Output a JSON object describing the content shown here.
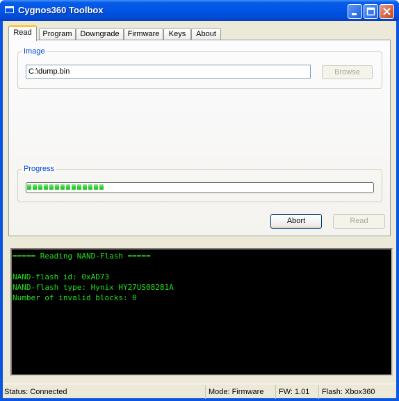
{
  "window": {
    "title": "Cygnos360 Toolbox"
  },
  "tabs": [
    {
      "label": "Read",
      "active": true
    },
    {
      "label": "Program",
      "active": false
    },
    {
      "label": "Downgrade",
      "active": false
    },
    {
      "label": "Firmware",
      "active": false
    },
    {
      "label": "Keys",
      "active": false
    },
    {
      "label": "About",
      "active": false
    }
  ],
  "image_group": {
    "label": "Image",
    "path_value": "C:\\dump.bin",
    "browse_label": "Browse"
  },
  "progress_group": {
    "label": "Progress",
    "progress_fraction": 0.23
  },
  "buttons": {
    "abort_label": "Abort",
    "read_label": "Read"
  },
  "console": {
    "lines": [
      "===== Reading NAND-Flash =====",
      "",
      "NAND-flash id: 0xAD73",
      "NAND-flash type: Hynix HY27US08281A",
      "Number of invalid blocks: 0"
    ]
  },
  "status": {
    "connection": "Status: Connected",
    "mode": "Mode: Firmware",
    "fw": "FW: 1.01",
    "flash": "Flash: Xbox360"
  },
  "colors": {
    "titlebar": "#0055e5",
    "console_bg": "#000000",
    "console_text": "#23e21a",
    "progress": "#2ed330",
    "group_label": "#0046d5"
  }
}
